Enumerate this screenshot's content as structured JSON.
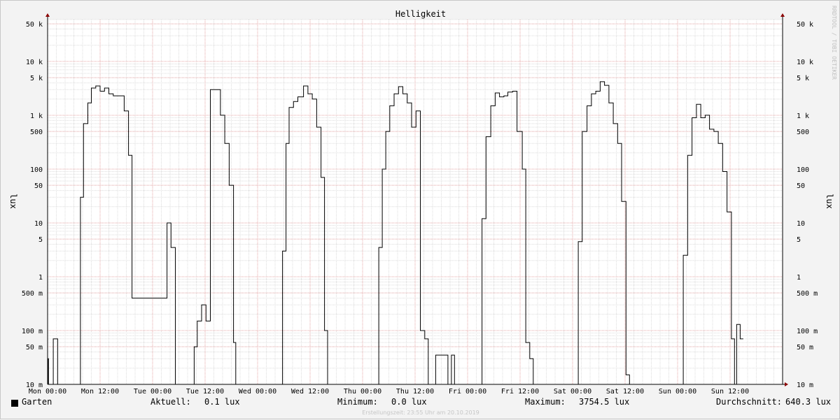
{
  "chart_data": {
    "type": "line",
    "title": "Helligkeit",
    "ylabel": "lux",
    "ylabel_right": "lux",
    "y_scale": "log",
    "ylim": [
      10,
      60000
    ],
    "y_ticks": [
      {
        "value": 10,
        "label": "10 m",
        "unit_scaled": 0.01
      },
      {
        "value": 50,
        "label": "50 m"
      },
      {
        "value": 100,
        "label": "100 m"
      },
      {
        "value": 500,
        "label": "500 m"
      },
      {
        "value": 1000,
        "label": "1"
      },
      {
        "value": 5000,
        "label": "5"
      },
      {
        "value": 10000,
        "label": "10"
      },
      {
        "value": 50000,
        "label": "50"
      },
      {
        "value": 100000,
        "label": "100"
      },
      {
        "value": 500000,
        "label": "500"
      },
      {
        "value": 1000000,
        "label": "1 k"
      },
      {
        "value": 5000000,
        "label": "5 k"
      },
      {
        "value": 10000000,
        "label": "10 k"
      },
      {
        "value": 50000000,
        "label": "50 k"
      }
    ],
    "x_ticks": [
      "Mon 00:00",
      "Mon 12:00",
      "Tue 00:00",
      "Tue 12:00",
      "Wed 00:00",
      "Wed 12:00",
      "Thu 00:00",
      "Thu 12:00",
      "Fri 00:00",
      "Fri 12:00",
      "Sat 00:00",
      "Sat 12:00",
      "Sun 00:00",
      "Sun 12:00"
    ],
    "x_unit": "hours since Mon 00:00",
    "xlim": [
      0,
      168
    ],
    "series": [
      {
        "name": "Garten",
        "color": "#000000",
        "points_mlux": [
          [
            0,
            10
          ],
          [
            0.1,
            30
          ],
          [
            0.2,
            10
          ],
          [
            1.2,
            10
          ],
          [
            1.3,
            70
          ],
          [
            2.2,
            70
          ],
          [
            2.3,
            10
          ],
          [
            7.3,
            10
          ],
          [
            7.5,
            30000
          ],
          [
            8.2,
            700000
          ],
          [
            9.2,
            1700000
          ],
          [
            10,
            3200000
          ],
          [
            11,
            3500000
          ],
          [
            12,
            2800000
          ],
          [
            13,
            3200000
          ],
          [
            14,
            2500000
          ],
          [
            15,
            2300000
          ],
          [
            17.5,
            1200000
          ],
          [
            18.5,
            180000
          ],
          [
            19.3,
            400
          ],
          [
            20,
            400
          ],
          [
            27.3,
            10000
          ],
          [
            28.2,
            3500
          ],
          [
            29.2,
            10
          ],
          [
            33.2,
            10
          ],
          [
            33.5,
            50
          ],
          [
            34.2,
            150
          ],
          [
            35.2,
            300
          ],
          [
            36.2,
            150
          ],
          [
            37.2,
            3000000
          ],
          [
            38.5,
            3000000
          ],
          [
            39.5,
            1000000
          ],
          [
            40.5,
            300000
          ],
          [
            41.5,
            50000
          ],
          [
            42.5,
            60
          ],
          [
            43,
            10
          ],
          [
            53.5,
            10
          ],
          [
            53.7,
            3000
          ],
          [
            54.5,
            300000
          ],
          [
            55.2,
            1400000
          ],
          [
            56.2,
            1800000
          ],
          [
            57.2,
            2200000
          ],
          [
            58.5,
            3500000
          ],
          [
            59.5,
            2500000
          ],
          [
            60.5,
            2000000
          ],
          [
            61.5,
            600000
          ],
          [
            62.5,
            70000
          ],
          [
            63.3,
            100
          ],
          [
            64,
            10
          ],
          [
            75.5,
            10
          ],
          [
            75.7,
            3500
          ],
          [
            76.5,
            100000
          ],
          [
            77.3,
            500000
          ],
          [
            78.2,
            1500000
          ],
          [
            79.2,
            2500000
          ],
          [
            80.2,
            3400000
          ],
          [
            81.2,
            2500000
          ],
          [
            82.2,
            1700000
          ],
          [
            83.2,
            600000
          ],
          [
            84.2,
            1200000
          ],
          [
            85.2,
            100
          ],
          [
            86.2,
            70
          ],
          [
            87,
            10
          ],
          [
            88.5,
            10
          ],
          [
            88.7,
            35
          ],
          [
            90.2,
            35
          ],
          [
            91,
            35
          ],
          [
            91.5,
            10
          ],
          [
            92,
            10
          ],
          [
            92.3,
            35
          ],
          [
            93,
            10
          ],
          [
            99,
            10
          ],
          [
            99.3,
            12000
          ],
          [
            100.2,
            400000
          ],
          [
            101.3,
            1500000
          ],
          [
            102.3,
            2600000
          ],
          [
            103.3,
            2200000
          ],
          [
            104.3,
            2300000
          ],
          [
            105.2,
            2700000
          ],
          [
            106.3,
            2800000
          ],
          [
            107.3,
            500000
          ],
          [
            108.5,
            100000
          ],
          [
            109.3,
            60
          ],
          [
            110.2,
            30
          ],
          [
            111,
            10
          ],
          [
            121,
            10
          ],
          [
            121.3,
            4500
          ],
          [
            122.2,
            500000
          ],
          [
            123.3,
            1500000
          ],
          [
            124.3,
            2500000
          ],
          [
            125.3,
            2800000
          ],
          [
            126.3,
            4200000
          ],
          [
            127.3,
            3600000
          ],
          [
            128.3,
            1700000
          ],
          [
            129.3,
            700000
          ],
          [
            130.3,
            300000
          ],
          [
            131.2,
            25000
          ],
          [
            132.2,
            15
          ],
          [
            133,
            10
          ],
          [
            145,
            10
          ],
          [
            145.3,
            2500
          ],
          [
            146.3,
            180000
          ],
          [
            147.3,
            900000
          ],
          [
            148.3,
            1600000
          ],
          [
            149.3,
            900000
          ],
          [
            150.3,
            1000000
          ],
          [
            151.3,
            550000
          ],
          [
            152.3,
            500000
          ],
          [
            153.3,
            300000
          ],
          [
            154.3,
            90000
          ],
          [
            155.3,
            16000
          ],
          [
            156.3,
            70
          ],
          [
            157,
            10
          ],
          [
            157.5,
            130
          ],
          [
            158.3,
            70
          ],
          [
            159,
            70
          ]
        ]
      }
    ],
    "legend": {
      "series_label": "Garten",
      "current_label": "Aktuell:",
      "current_value": "0.1 lux",
      "min_label": "Minimum:",
      "min_value": "0.0 lux",
      "max_label": "Maximum:",
      "max_value": "3754.5 lux",
      "avg_label": "Durchschnitt:",
      "avg_value": "640.3 lux"
    },
    "footer": "Erstellungszeit: 23:55 Uhr am 20.10.2019",
    "watermark": "RRDTOOL / TOBI OETIKER",
    "grid": true,
    "legend_position": "bottom"
  }
}
